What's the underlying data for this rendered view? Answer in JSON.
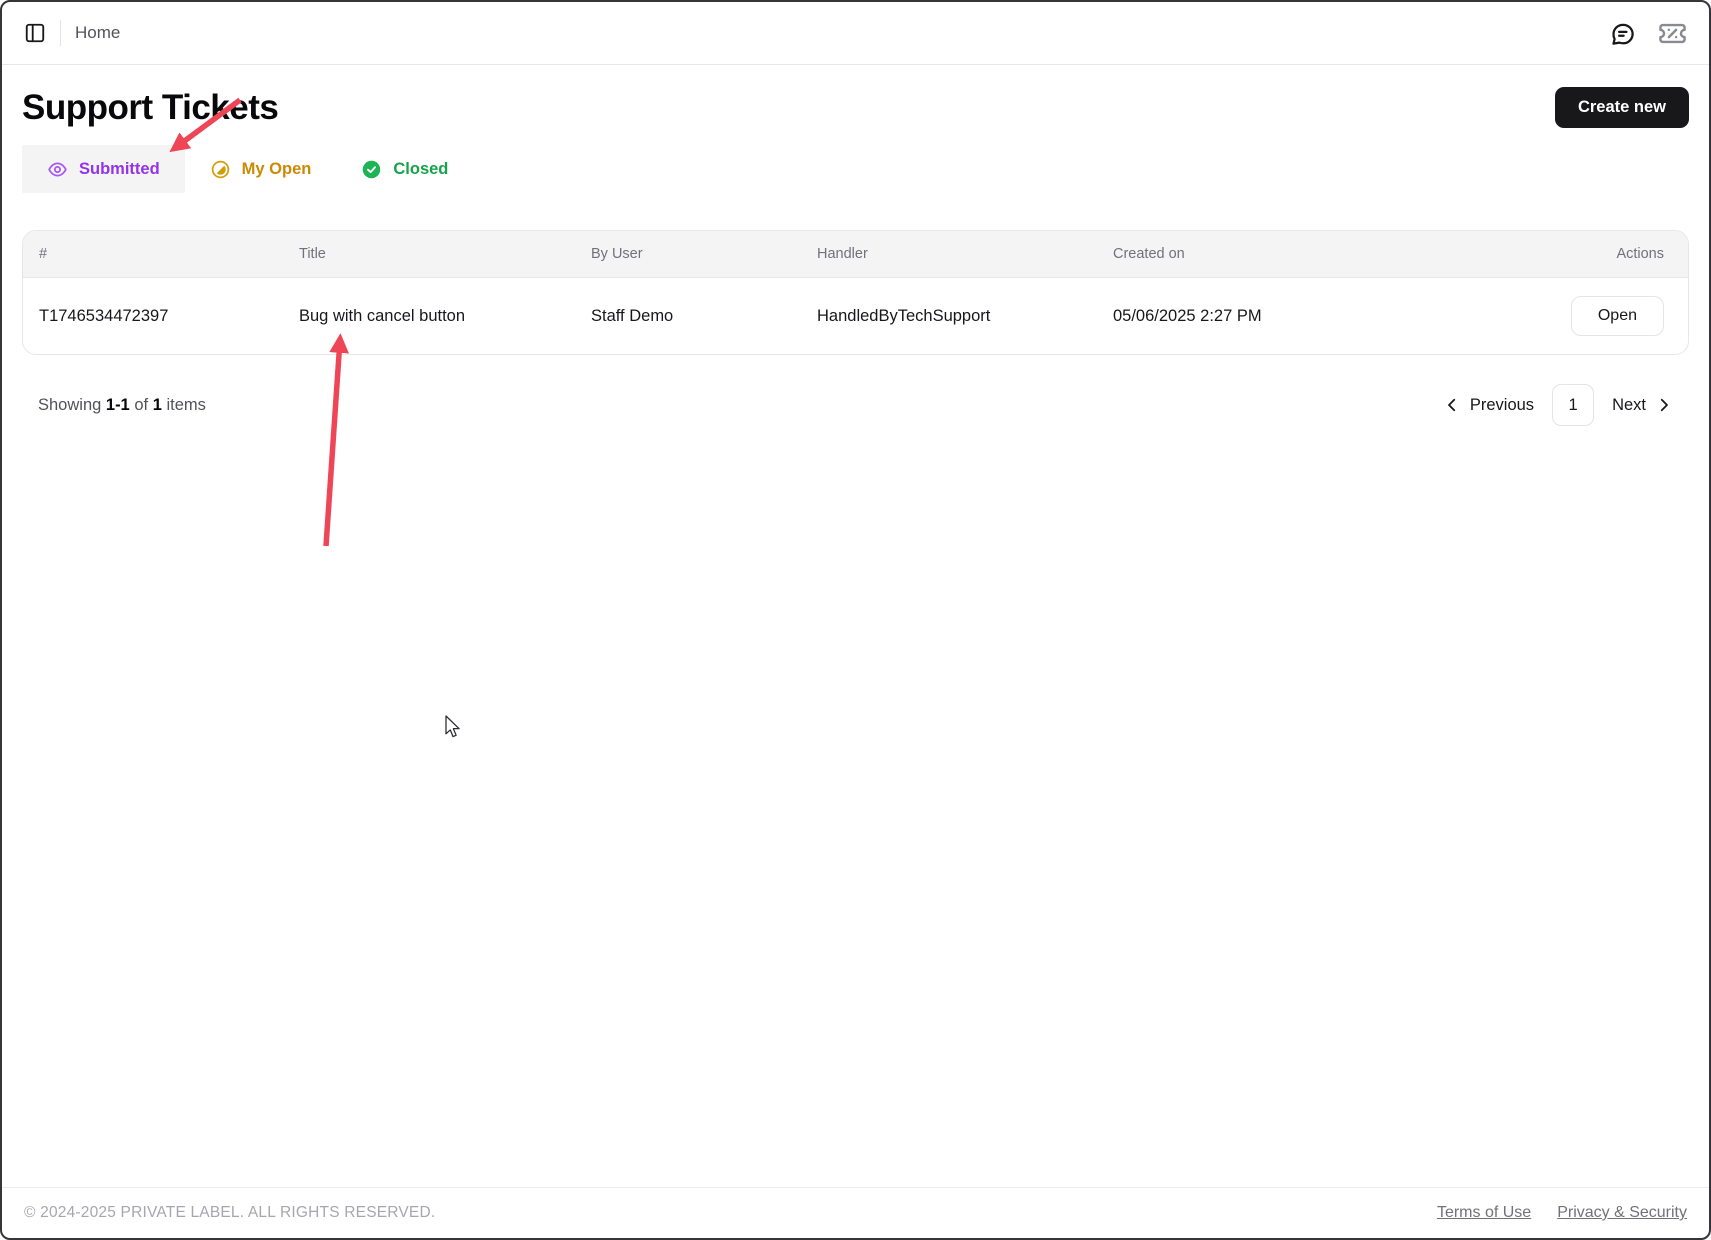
{
  "topbar": {
    "breadcrumb": "Home"
  },
  "page": {
    "title": "Support Tickets",
    "create_button": "Create new"
  },
  "tabs": [
    {
      "label": "Submitted",
      "icon": "eye-icon",
      "color": "#9333ea",
      "active": true
    },
    {
      "label": "My Open",
      "icon": "half-circle-icon",
      "color": "#ca8a04",
      "active": false
    },
    {
      "label": "Closed",
      "icon": "check-circle-icon",
      "color": "#16a34a",
      "active": false
    }
  ],
  "table": {
    "columns": [
      "#",
      "Title",
      "By User",
      "Handler",
      "Created on",
      "Actions"
    ],
    "rows": [
      {
        "id": "T1746534472397",
        "title": "Bug with cancel button",
        "by_user": "Staff Demo",
        "handler": "HandledByTechSupport",
        "created_on": "05/06/2025 2:27 PM",
        "action": "Open"
      }
    ]
  },
  "pagination": {
    "showing_prefix": "Showing",
    "range": "1-1",
    "of_word": "of",
    "total": "1",
    "items_word": "items",
    "previous": "Previous",
    "page": "1",
    "next": "Next"
  },
  "footer": {
    "copyright": "© 2024-2025 PRIVATE LABEL. ALL RIGHTS RESERVED.",
    "links": [
      {
        "label": "Terms of Use"
      },
      {
        "label": "Privacy & Security"
      }
    ]
  },
  "annotations": {
    "arrow_color": "#ee4656",
    "arrows": [
      "points-to-submitted-tab",
      "points-to-ticket-row-title"
    ]
  }
}
